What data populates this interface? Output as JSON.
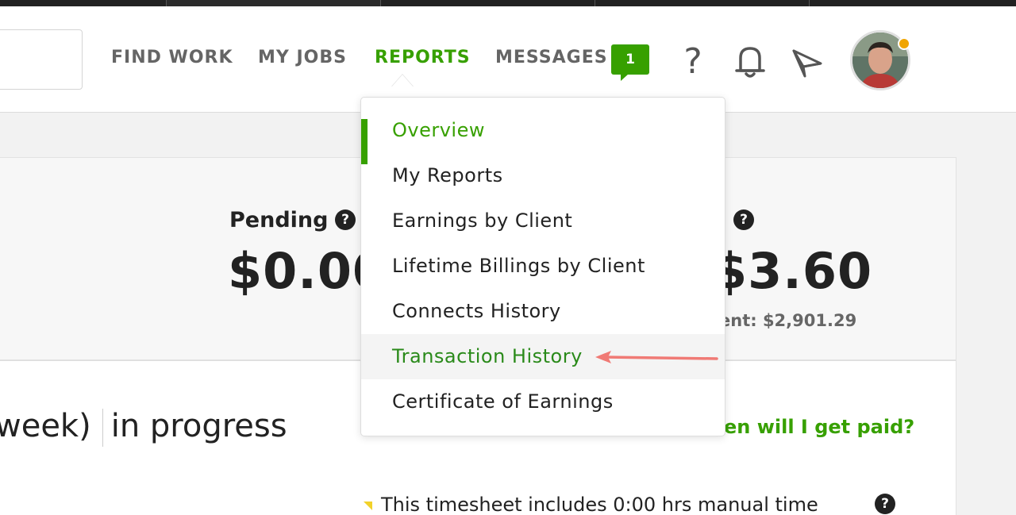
{
  "nav": {
    "find_work": "FIND WORK",
    "my_jobs": "MY JOBS",
    "reports": "REPORTS",
    "messages": "MESSAGES",
    "messages_count": "1"
  },
  "header_icons": {
    "help": "?",
    "help_icon": "question-mark-icon",
    "notifications_icon": "bell-icon",
    "send_icon": "paper-plane-icon"
  },
  "reports_menu": {
    "items": [
      {
        "label": "Overview"
      },
      {
        "label": "My Reports"
      },
      {
        "label": "Earnings by Client"
      },
      {
        "label": "Lifetime Billings by Client"
      },
      {
        "label": "Connects History"
      },
      {
        "label": "Transaction History"
      },
      {
        "label": "Certificate of Earnings"
      }
    ],
    "active_index": 0,
    "highlighted_index": 5
  },
  "summary": {
    "pending_label": "Pending",
    "pending_value": "$0.00",
    "available_value": "$3.60",
    "available_sub": "ent: $2,901.29",
    "help_glyph": "?"
  },
  "timesheet": {
    "title_left": "week)",
    "title_right": "in progress",
    "paid_link": "en will I get paid?",
    "note": "This timesheet includes 0:00 hrs manual time"
  },
  "colors": {
    "accent": "#37a000",
    "nav_text": "#656565",
    "status_dot": "#f0a500",
    "arrow": "#f07a75"
  }
}
